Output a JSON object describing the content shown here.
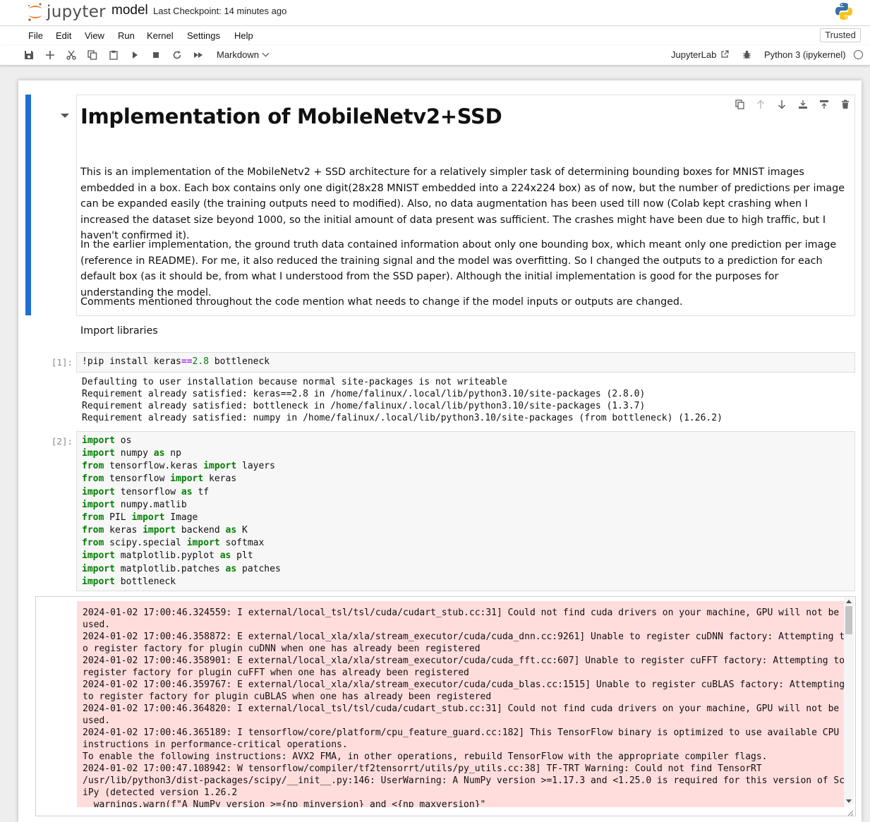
{
  "app": {
    "logo_text": "jupyter",
    "notebook_name": "model",
    "checkpoint": "Last Checkpoint: 14 minutes ago",
    "trusted_label": "Trusted"
  },
  "menu": [
    "File",
    "Edit",
    "View",
    "Run",
    "Kernel",
    "Settings",
    "Help"
  ],
  "toolbar": {
    "cell_type": "Markdown",
    "jupyterlab_label": "JupyterLab",
    "kernel_name": "Python 3 (ipykernel)"
  },
  "markdown_cell": {
    "heading": "Implementation of MobileNetv2+SSD",
    "paragraphs": [
      "This is an implementation of the MobileNetv2 + SSD architecture for a relatively simpler task of determining bounding boxes for MNIST images embedded in a box. Each box contains only one digit(28x28 MNIST embedded into a 224x224 box) as of now, but the number of predictions per image can be expanded easily (the training outputs need to modified). Also, no data augmentation has been used till now (Colab kept crashing when I increased the dataset size beyond 1000, so the initial amount of data present was sufficient. The crashes might have been due to high traffic, but I haven't confirmed it).",
      "In the earlier implementation, the ground truth data contained information about only one bounding box, which meant only one prediction per image (reference in README). For me, it also reduced the training signal and the model was overfitting. So I changed the outputs to a prediction for each default box (as it should be, from what I understood from the SSD paper). Although the initial implementation is good for the purposes for understanding the model.",
      "Comments mentioned throughout the code mention what needs to change if the model inputs or outputs are changed."
    ]
  },
  "import_md": "Import libraries",
  "cell1": {
    "prompt": "[1]:",
    "code": {
      "a": "!pip install keras",
      "op": "==",
      "num": "2.8",
      "b": " bottleneck"
    },
    "output": "Defaulting to user installation because normal site-packages is not writeable\nRequirement already satisfied: keras==2.8 in /home/falinux/.local/lib/python3.10/site-packages (2.8.0)\nRequirement already satisfied: bottleneck in /home/falinux/.local/lib/python3.10/site-packages (1.3.7)\nRequirement already satisfied: numpy in /home/falinux/.local/lib/python3.10/site-packages (from bottleneck) (1.26.2)"
  },
  "cell2": {
    "prompt": "[2]:",
    "lines": [
      [
        [
          "kw",
          "import"
        ],
        [
          "t",
          " os"
        ]
      ],
      [
        [
          "kw",
          "import"
        ],
        [
          "t",
          " numpy "
        ],
        [
          "kw",
          "as"
        ],
        [
          "t",
          " np"
        ]
      ],
      [
        [
          "kw",
          "from"
        ],
        [
          "t",
          " tensorflow.keras "
        ],
        [
          "kw",
          "import"
        ],
        [
          "t",
          " layers"
        ]
      ],
      [
        [
          "kw",
          "from"
        ],
        [
          "t",
          " tensorflow "
        ],
        [
          "kw",
          "import"
        ],
        [
          "t",
          " keras"
        ]
      ],
      [
        [
          "kw",
          "import"
        ],
        [
          "t",
          " tensorflow "
        ],
        [
          "kw",
          "as"
        ],
        [
          "t",
          " tf"
        ]
      ],
      [
        [
          "kw",
          "import"
        ],
        [
          "t",
          " numpy.matlib"
        ]
      ],
      [
        [
          "kw",
          "from"
        ],
        [
          "t",
          " PIL "
        ],
        [
          "kw",
          "import"
        ],
        [
          "t",
          " Image"
        ]
      ],
      [
        [
          "kw",
          "from"
        ],
        [
          "t",
          " keras "
        ],
        [
          "kw",
          "import"
        ],
        [
          "t",
          " backend "
        ],
        [
          "kw",
          "as"
        ],
        [
          "t",
          " K"
        ]
      ],
      [
        [
          "kw",
          "from"
        ],
        [
          "t",
          " scipy.special "
        ],
        [
          "kw",
          "import"
        ],
        [
          "t",
          " softmax"
        ]
      ],
      [
        [
          "kw",
          "import"
        ],
        [
          "t",
          " matplotlib.pyplot "
        ],
        [
          "kw",
          "as"
        ],
        [
          "t",
          " plt"
        ]
      ],
      [
        [
          "kw",
          "import"
        ],
        [
          "t",
          " matplotlib.patches "
        ],
        [
          "kw",
          "as"
        ],
        [
          "t",
          " patches"
        ]
      ],
      [
        [
          "kw",
          "import"
        ],
        [
          "t",
          " bottleneck"
        ]
      ]
    ],
    "stderr": "2024-01-02 17:00:46.324559: I external/local_tsl/tsl/cuda/cudart_stub.cc:31] Could not find cuda drivers on your machine, GPU will not be\nused.\n2024-01-02 17:00:46.358872: E external/local_xla/xla/stream_executor/cuda/cuda_dnn.cc:9261] Unable to register cuDNN factory: Attempting t\no register factory for plugin cuDNN when one has already been registered\n2024-01-02 17:00:46.358901: E external/local_xla/xla/stream_executor/cuda/cuda_fft.cc:607] Unable to register cuFFT factory: Attempting to\nregister factory for plugin cuFFT when one has already been registered\n2024-01-02 17:00:46.359767: E external/local_xla/xla/stream_executor/cuda/cuda_blas.cc:1515] Unable to register cuBLAS factory: Attempting\nto register factory for plugin cuBLAS when one has already been registered\n2024-01-02 17:00:46.364820: I external/local_tsl/tsl/cuda/cudart_stub.cc:31] Could not find cuda drivers on your machine, GPU will not be\nused.\n2024-01-02 17:00:46.365189: I tensorflow/core/platform/cpu_feature_guard.cc:182] This TensorFlow binary is optimized to use available CPU\ninstructions in performance-critical operations.\nTo enable the following instructions: AVX2 FMA, in other operations, rebuild TensorFlow with the appropriate compiler flags.\n2024-01-02 17:00:47.108942: W tensorflow/compiler/tf2tensorrt/utils/py_utils.cc:38] TF-TRT Warning: Could not find TensorRT\n/usr/lib/python3/dist-packages/scipy/__init__.py:146: UserWarning: A NumPy version >=1.17.3 and <1.25.0 is required for this version of Sc\niPy (detected version 1.26.2\n  warnings.warn(f\"A NumPy version >={np_minversion} and <{np_maxversion}\""
  },
  "icons": {
    "toolbar": [
      "save-icon",
      "add-cell-icon",
      "cut-icon",
      "copy-icon",
      "paste-icon",
      "run-icon",
      "stop-icon",
      "restart-icon",
      "fast-forward-icon"
    ],
    "cell_tools": [
      "duplicate-icon",
      "move-up-icon",
      "move-down-icon",
      "insert-above-icon",
      "insert-below-icon",
      "delete-icon"
    ]
  },
  "colors": {
    "selection_bar": "#1e6fd3",
    "stderr_bg": "#ffdddd",
    "keyword": "#008000",
    "operator": "#aa22ff"
  }
}
